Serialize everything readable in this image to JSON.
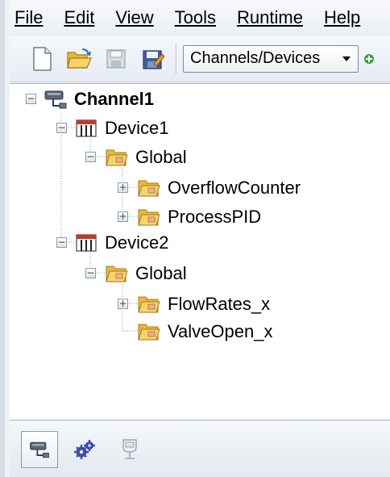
{
  "menu": {
    "items": [
      {
        "label": "File"
      },
      {
        "label": "Edit"
      },
      {
        "label": "View"
      },
      {
        "label": "Tools"
      },
      {
        "label": "Runtime"
      },
      {
        "label": "Help"
      }
    ]
  },
  "toolbar": {
    "icons": [
      "new-project-icon",
      "open-project-icon",
      "save-icon",
      "save-as-icon"
    ],
    "view_selector": {
      "value": "Channels/Devices"
    }
  },
  "tree": {
    "channel": {
      "label": "Channel1",
      "icon": "channel-icon"
    },
    "device1": {
      "label": "Device1",
      "icon": "device-icon"
    },
    "device1_global": {
      "label": "Global",
      "icon": "folder-icon"
    },
    "overflow_counter": {
      "label": "OverflowCounter",
      "icon": "folder-icon"
    },
    "process_pid": {
      "label": "ProcessPID",
      "icon": "folder-icon"
    },
    "device2": {
      "label": "Device2",
      "icon": "device-icon"
    },
    "device2_global": {
      "label": "Global",
      "icon": "folder-icon"
    },
    "flow_rates": {
      "label": "FlowRates_x",
      "icon": "folder-icon"
    },
    "valve_open": {
      "label": "ValveOpen_x",
      "icon": "folder-icon"
    }
  },
  "bottom_tabs": {
    "icons": [
      "channels-devices-view-icon",
      "config-gear-view-icon",
      "alias-view-icon"
    ],
    "active": "channels-devices-view-icon"
  },
  "colors": {
    "folder": "#f4c542",
    "device_stripe": "#c0392b",
    "accent": "#2f6db5"
  }
}
